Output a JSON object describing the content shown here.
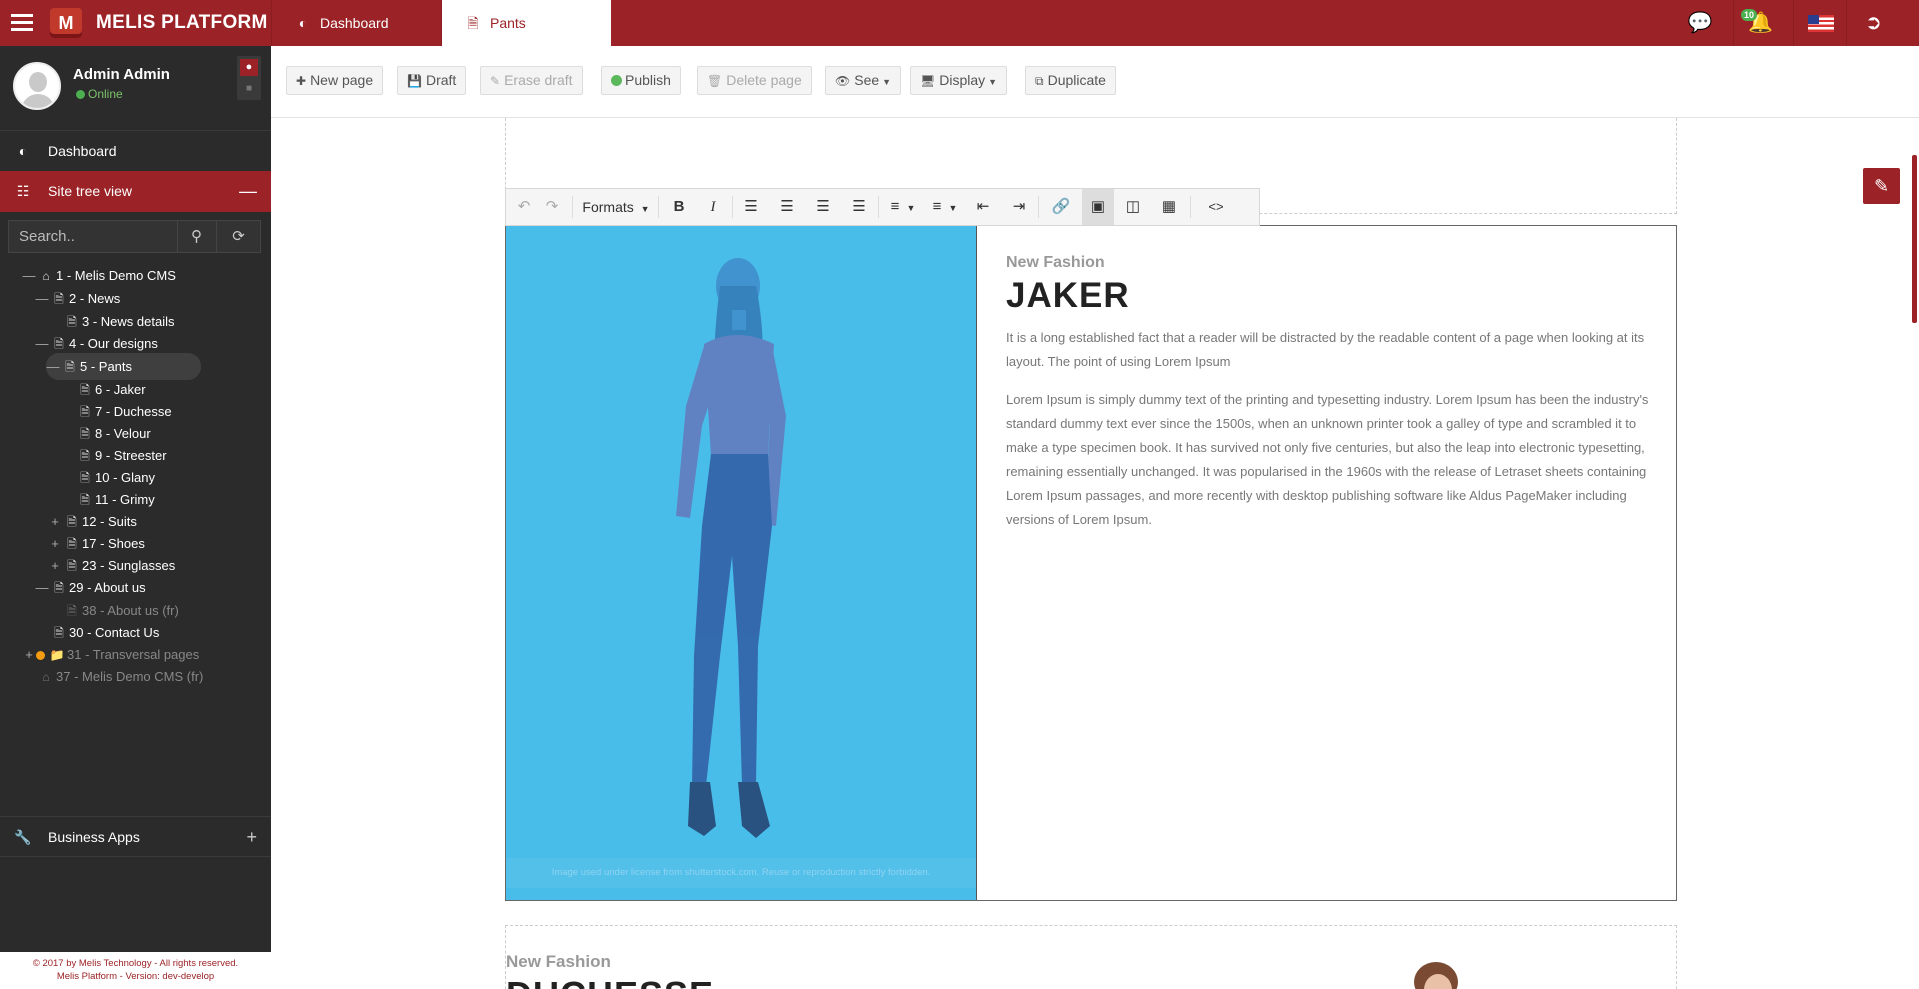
{
  "topbar": {
    "brand": "MELIS PLATFORM",
    "logo_letter": "M",
    "tabs": [
      {
        "label": "Dashboard",
        "icon": "dashboard-icon"
      },
      {
        "label": "Pants",
        "icon": "page-icon"
      }
    ],
    "notifications_count": "10",
    "icons": [
      "chat-icon",
      "bell-icon",
      "us-flag-icon",
      "logout-icon"
    ]
  },
  "user": {
    "name": "Admin Admin",
    "status": "Online"
  },
  "sidebar": {
    "dashboard_label": "Dashboard",
    "site_tree_label": "Site tree view",
    "business_apps_label": "Business Apps",
    "search_placeholder": "Search..",
    "tree": [
      {
        "label": "1 - Melis Demo CMS",
        "toggle": "—",
        "icon": "home-icon",
        "dim": false
      },
      {
        "label": "2 - News",
        "toggle": "—",
        "icon": "page-icon",
        "dim": false
      },
      {
        "label": "3 - News details",
        "toggle": "",
        "icon": "page-icon",
        "dim": false
      },
      {
        "label": "4 - Our designs",
        "toggle": "—",
        "icon": "page-icon",
        "dim": false
      },
      {
        "label": "5 - Pants",
        "toggle": "—",
        "icon": "page-icon",
        "dim": false,
        "selected": true
      },
      {
        "label": "6 - Jaker",
        "toggle": "",
        "icon": "page-icon",
        "dim": false
      },
      {
        "label": "7 - Duchesse",
        "toggle": "",
        "icon": "page-icon",
        "dim": false
      },
      {
        "label": "8 - Velour",
        "toggle": "",
        "icon": "page-icon",
        "dim": false
      },
      {
        "label": "9 - Streester",
        "toggle": "",
        "icon": "page-icon",
        "dim": false
      },
      {
        "label": "10 - Glany",
        "toggle": "",
        "icon": "page-icon",
        "dim": false
      },
      {
        "label": "11 - Grimy",
        "toggle": "",
        "icon": "page-icon",
        "dim": false
      },
      {
        "label": "12 - Suits",
        "toggle": "+",
        "icon": "page-icon",
        "dim": false
      },
      {
        "label": "17 - Shoes",
        "toggle": "+",
        "icon": "page-icon",
        "dim": false
      },
      {
        "label": "23 - Sunglasses",
        "toggle": "+",
        "icon": "page-icon",
        "dim": false
      },
      {
        "label": "29 - About us",
        "toggle": "—",
        "icon": "page-icon",
        "dim": false
      },
      {
        "label": "38 - About us (fr)",
        "toggle": "",
        "icon": "page-icon",
        "dim": true
      },
      {
        "label": "30 - Contact Us",
        "toggle": "",
        "icon": "page-icon",
        "dim": false
      },
      {
        "label": "31 - Transversal pages",
        "toggle": "+",
        "icon": "folder-icon",
        "dim": true,
        "status": "unpublished"
      },
      {
        "label": "37 - Melis Demo CMS (fr)",
        "toggle": "",
        "icon": "home-icon",
        "dim": true
      }
    ],
    "footer_line1": "© 2017 by Melis Technology - All rights reserved.",
    "footer_line2": "Melis Platform - Version: dev-develop"
  },
  "toolbar": {
    "new_page": "New page",
    "draft": "Draft",
    "erase_draft": "Erase draft",
    "publish": "Publish",
    "delete_page": "Delete page",
    "see": "See",
    "display": "Display",
    "duplicate": "Duplicate"
  },
  "editor": {
    "formats_label": "Formats",
    "buttons": [
      "undo-icon",
      "redo-icon",
      "bold-icon",
      "italic-icon",
      "align-left-icon",
      "align-center-icon",
      "align-right-icon",
      "align-justify-icon",
      "bullet-list-icon",
      "numbered-list-icon",
      "outdent-icon",
      "indent-icon",
      "link-icon",
      "image-icon",
      "media-icon",
      "table-icon",
      "code-icon"
    ]
  },
  "content": {
    "block1": {
      "subtitle": "New Fashion",
      "title": "JAKER",
      "para1": "It is a long established fact that a reader will be distracted by the readable content of a page when looking at its layout. The point of using Lorem Ipsum",
      "para2": "Lorem Ipsum is simply dummy text of the printing and typesetting industry. Lorem Ipsum has been the industry's standard dummy text ever since the 1500s, when an unknown printer took a galley of type and scrambled it to make a type specimen book. It has survived not only five centuries, but also the leap into electronic typesetting, remaining essentially unchanged. It was popularised in the 1960s with the release of Letraset sheets containing Lorem Ipsum passages, and more recently with desktop publishing software like Aldus PageMaker including versions of Lorem Ipsum.",
      "image_caption": "Image used under license from shutterstock.com. Reuse or reproduction strictly forbidden."
    },
    "block2": {
      "subtitle": "New Fashion",
      "title": "DUCHESSE"
    }
  },
  "colors": {
    "brand": "#9b2226",
    "sidebar": "#2b2b2b",
    "image_overlay": "#49bde9"
  }
}
